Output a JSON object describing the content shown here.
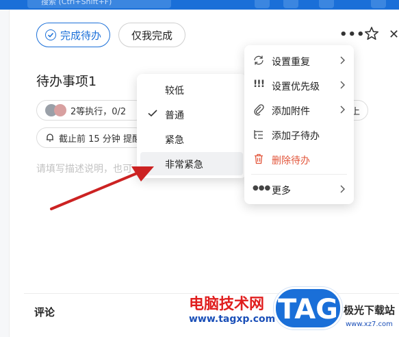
{
  "top_bar": {
    "search_placeholder": "搜索 (Ctrl+Shift+F)"
  },
  "toolbar": {
    "complete_label": "完成待办",
    "only_me_label": "仅我完成"
  },
  "task": {
    "title": "待办事项1",
    "executors_text": "2等执行，0/2",
    "reminder_text": "截止前 15 分钟 提醒",
    "right_chip_text": "上",
    "description_placeholder": "请填写描述说明，也可"
  },
  "priority_menu": {
    "items": [
      {
        "label": "较低",
        "checked": false
      },
      {
        "label": "普通",
        "checked": true
      },
      {
        "label": "紧急",
        "checked": false
      },
      {
        "label": "非常紧急",
        "checked": false,
        "hovered": true
      }
    ]
  },
  "more_menu": {
    "items": [
      {
        "label": "设置重复",
        "icon": "repeat-icon",
        "has_submenu": true
      },
      {
        "label": "设置优先级",
        "icon": "priority-icon",
        "has_submenu": true
      },
      {
        "label": "添加附件",
        "icon": "paperclip-icon",
        "has_submenu": true
      },
      {
        "label": "添加子待办",
        "icon": "subtask-icon",
        "has_submenu": false
      },
      {
        "label": "删除待办",
        "icon": "trash-icon",
        "has_submenu": false,
        "danger": true
      }
    ],
    "more_label": "更多"
  },
  "comments": {
    "heading": "评论"
  },
  "watermark": {
    "site_name": "电脑技术网",
    "site_url": "www.tagxp.com",
    "logo_text": "TAG",
    "xz_name": "极光下载站",
    "xz_url": "www.xz7.com"
  },
  "colors": {
    "accent": "#1a6fd8",
    "danger": "#e2553a",
    "arrow": "#cc2222"
  }
}
